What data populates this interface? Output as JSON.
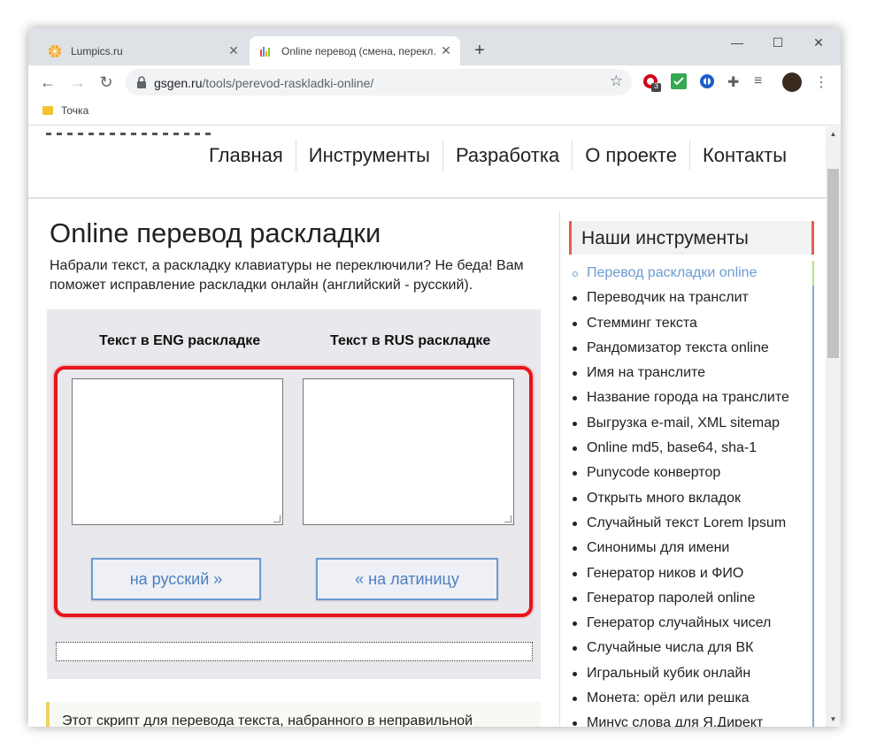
{
  "browser": {
    "tabs": [
      {
        "title": "Lumpics.ru",
        "active": false
      },
      {
        "title": "Online перевод (смена, перекл…",
        "active": true
      }
    ],
    "new_tab_label": "+",
    "window_controls": {
      "minimize": "—",
      "maximize": "☐",
      "close": "✕"
    },
    "url_host": "gsgen.ru",
    "url_path": "/tools/perevod-raskladki-online/",
    "bookmark": "Точка",
    "extension_badge": "3"
  },
  "site_nav": [
    "Главная",
    "Инструменты",
    "Разработка",
    "О проекте",
    "Контакты"
  ],
  "main": {
    "title": "Online перевод раскладки",
    "intro": "Набрали текст, а раскладку клавиатуры не переключили? Не беда! Вам поможет исправление раскладки онлайн (английский - русский).",
    "eng_header": "Текст в ENG раскладке",
    "rus_header": "Текст в RUS раскладке",
    "eng_value": "",
    "rus_value": "",
    "to_russian_button": "на русский »",
    "to_latin_button": "« на латиницу",
    "notice": "Этот скрипт для перевода текста, набранного в неправильной"
  },
  "sidebar": {
    "title": "Наши инструменты",
    "items": [
      "Перевод раскладки online",
      "Переводчик на транслит",
      "Стемминг текста",
      "Рандомизатор текста online",
      "Имя на транслите",
      "Название города на транслите",
      "Выгрузка e-mail, XML sitemap",
      "Online md5, base64, sha-1",
      "Punycode конвертор",
      "Открыть много вкладок",
      "Случайный текст Lorem Ipsum",
      "Синонимы для имени",
      "Генератор ников и ФИО",
      "Генератор паролей online",
      "Генератор случайных чисел",
      "Случайные числа для ВК",
      "Игральный кубик онлайн",
      "Монета: орёл или решка",
      "Минус слова для Я.Директ"
    ],
    "active_index": 0
  },
  "colors": {
    "highlight_frame": "#e8141b",
    "button_text": "#4a7fc1",
    "sidebar_accent": "#e06055"
  }
}
